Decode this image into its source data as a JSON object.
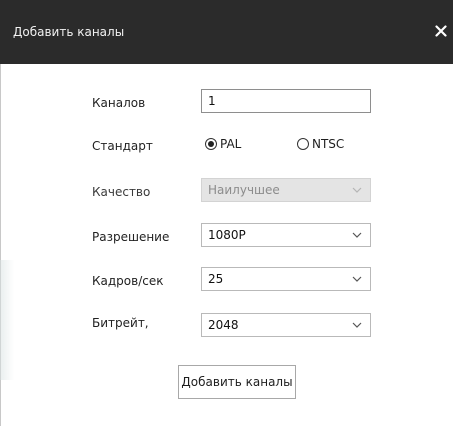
{
  "window": {
    "title": "Добавить каналы",
    "close_icon": "close-icon"
  },
  "form": {
    "channels": {
      "label": "Каналов",
      "value": "1"
    },
    "standard": {
      "label": "Стандарт",
      "options": [
        {
          "label": "PAL",
          "checked": true
        },
        {
          "label": "NTSC",
          "checked": false
        }
      ]
    },
    "quality": {
      "label": "Качество",
      "value": "Наилучшее",
      "disabled": true
    },
    "resolution": {
      "label": "Разрешение",
      "value": "1080P"
    },
    "fps": {
      "label": "Кадров/сек",
      "value": "25"
    },
    "bitrate": {
      "label": "Битрейт,",
      "value": "2048"
    }
  },
  "actions": {
    "add_label": "Добавить каналы"
  },
  "colors": {
    "titlebar": "#2b2b2b",
    "disabled_field": "#e4e4e4"
  }
}
